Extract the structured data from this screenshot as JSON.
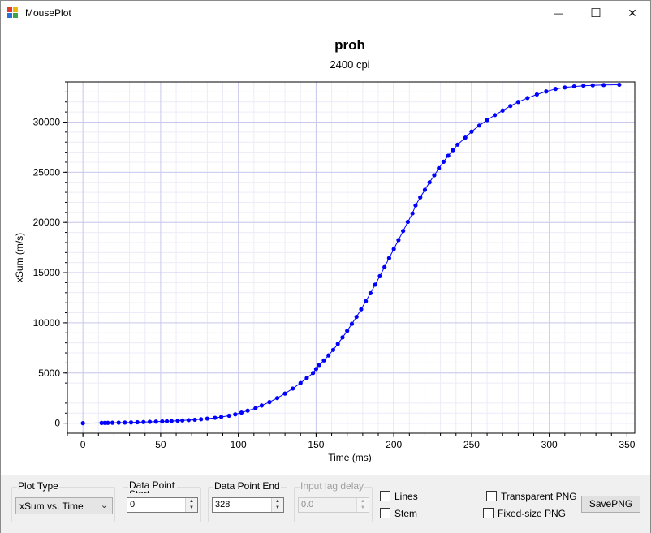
{
  "window": {
    "title": "MousePlot",
    "minimize_glyph": "—",
    "maximize_glyph": "☐",
    "close_glyph": "✕"
  },
  "chart_data": {
    "type": "line",
    "title": "proh",
    "subtitle": "2400 cpi",
    "xlabel": "Time (ms)",
    "ylabel": "xSum (m/s)",
    "xlim": [
      -10,
      355
    ],
    "ylim": [
      -1000,
      34000
    ],
    "xticks": [
      0,
      50,
      100,
      150,
      200,
      250,
      300,
      350
    ],
    "yticks": [
      0,
      5000,
      10000,
      15000,
      20000,
      25000,
      30000
    ],
    "grid": true,
    "marker": "circle",
    "line_color": "#0000ff",
    "series": [
      {
        "name": "",
        "x": [
          0,
          12,
          14,
          16,
          19,
          23,
          27,
          31,
          35,
          39,
          43,
          47,
          51,
          54,
          57,
          61,
          64,
          68,
          72,
          76,
          80,
          85,
          89,
          94,
          98,
          102,
          106,
          111,
          115,
          120,
          125,
          130,
          135,
          140,
          144,
          148,
          150,
          152,
          155,
          158,
          161,
          164,
          167,
          170,
          173,
          176,
          179,
          182,
          185,
          188,
          191,
          194,
          197,
          200,
          203,
          206,
          209,
          212,
          214,
          217,
          220,
          223,
          226,
          229,
          232,
          235,
          238,
          241,
          246,
          250,
          255,
          260,
          265,
          270,
          275,
          280,
          286,
          292,
          298,
          304,
          310,
          316,
          322,
          328,
          335,
          345
        ],
        "y": [
          0,
          20,
          25,
          30,
          40,
          50,
          60,
          70,
          90,
          110,
          130,
          150,
          170,
          190,
          210,
          240,
          270,
          300,
          340,
          390,
          450,
          530,
          620,
          740,
          880,
          1050,
          1250,
          1480,
          1760,
          2100,
          2500,
          2950,
          3450,
          4000,
          4500,
          5000,
          5400,
          5800,
          6250,
          6750,
          7300,
          7900,
          8550,
          9200,
          9900,
          10600,
          11350,
          12150,
          12950,
          13800,
          14650,
          15550,
          16450,
          17350,
          18250,
          19150,
          20050,
          20900,
          21700,
          22500,
          23250,
          24000,
          24700,
          25400,
          26050,
          26650,
          27200,
          27750,
          28450,
          29050,
          29650,
          30200,
          30700,
          31150,
          31600,
          32000,
          32400,
          32750,
          33050,
          33300,
          33450,
          33550,
          33620,
          33660,
          33690,
          33720
        ]
      }
    ]
  },
  "controls": {
    "plot_type": {
      "label": "Plot Type",
      "value": "xSum vs. Time"
    },
    "data_point_start": {
      "label": "Data Point Start",
      "value": "0"
    },
    "data_point_end": {
      "label": "Data Point End",
      "value": "328"
    },
    "input_lag_delay": {
      "label": "Input lag delay",
      "value": "0.0"
    },
    "lines_label": "Lines",
    "stem_label": "Stem",
    "transparent_png_label": "Transparent PNG",
    "fixed_size_png_label": "Fixed-size PNG",
    "save_png_label": "SavePNG"
  }
}
